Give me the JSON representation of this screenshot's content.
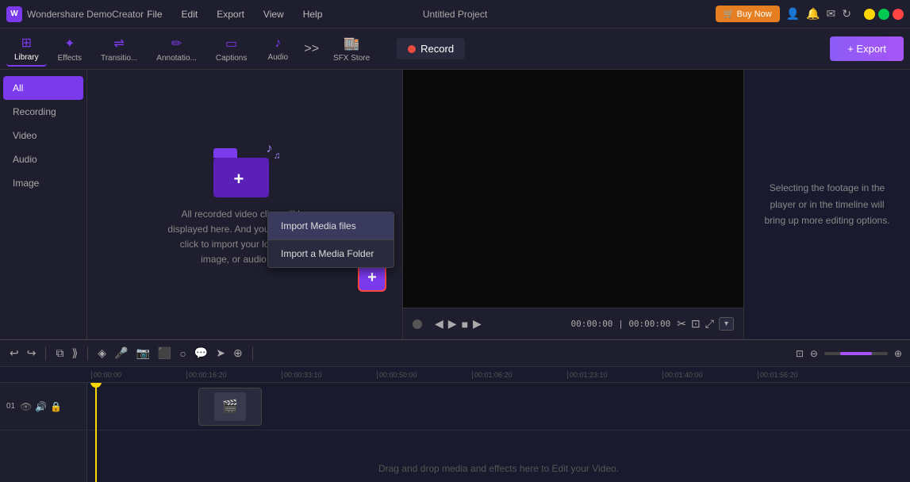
{
  "app": {
    "name": "Wondershare DemoCreator",
    "logo_text": "W",
    "project_title": "Untitled Project"
  },
  "menu": {
    "items": [
      "File",
      "Edit",
      "Export",
      "View",
      "Help"
    ]
  },
  "titlebar": {
    "buy_label": "🛒 Buy Now"
  },
  "toolbar": {
    "items": [
      {
        "id": "library",
        "label": "Library",
        "icon": "⊞"
      },
      {
        "id": "effects",
        "label": "Effects",
        "icon": "✦"
      },
      {
        "id": "transitions",
        "label": "Transitio...",
        "icon": "⇌"
      },
      {
        "id": "annotations",
        "label": "Annotatio...",
        "icon": "✏"
      },
      {
        "id": "captions",
        "label": "Captions",
        "icon": "▭"
      },
      {
        "id": "audio",
        "label": "Audio",
        "icon": "♪"
      },
      {
        "id": "sfxstore",
        "label": "SFX Store",
        "icon": "🏬"
      }
    ],
    "record_label": "Record",
    "export_label": "+ Export",
    "more_icon": ">>"
  },
  "sidebar": {
    "items": [
      {
        "id": "all",
        "label": "All",
        "active": true
      },
      {
        "id": "recording",
        "label": "Recording"
      },
      {
        "id": "video",
        "label": "Video"
      },
      {
        "id": "audio",
        "label": "Audio"
      },
      {
        "id": "image",
        "label": "Image"
      }
    ]
  },
  "media_panel": {
    "empty_text": "All recorded video clips will be displayed here. And you can double-click to import your local video, image, or audio files.",
    "add_icon": "+",
    "import_dropdown": {
      "items": [
        {
          "id": "import-files",
          "label": "Import Media files"
        },
        {
          "id": "import-folder",
          "label": "Import a Media Folder"
        }
      ]
    }
  },
  "preview": {
    "time_current": "00:00:00",
    "time_total": "00:00:00",
    "separator": "|"
  },
  "hint_panel": {
    "text": "Selecting the footage in the player or in the timeline will bring up more editing options."
  },
  "timeline": {
    "toolbar_icons": [
      "↩",
      "↪",
      "⧉",
      "⟩⟩",
      "◈",
      "🎤",
      "★",
      "⬛",
      "◎",
      "💬",
      "➤",
      "⊕",
      "⊕"
    ],
    "ruler_marks": [
      "00:00:00",
      "00:00:16:20",
      "00:00:33:10",
      "00:00:50:00",
      "00:01:06:20",
      "00:01:23:10",
      "00:01:40:00",
      "00:01:56:20"
    ],
    "empty_hint": "Drag and drop media and effects here to Edit your Video.",
    "zoom_icon_minus": "⊖",
    "zoom_icon_plus": "⊕"
  }
}
